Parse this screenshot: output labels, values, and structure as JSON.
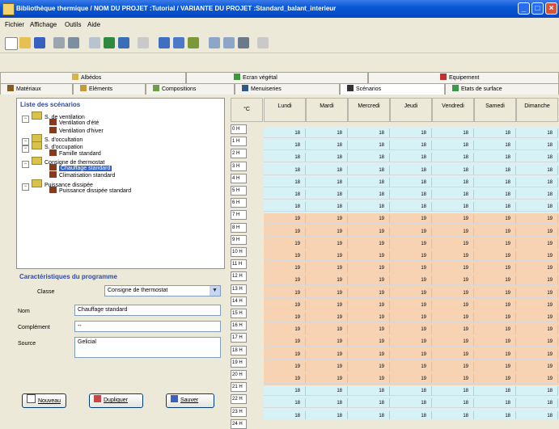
{
  "window": {
    "title": "Bibliothèque thermique / NOM DU PROJET :Tutorial / VARIANTE DU PROJET :Standard_balant_interieur"
  },
  "menu": [
    "Fichier",
    "Affichage",
    "Outils",
    "Aide"
  ],
  "tabs_row1": [
    {
      "label": "Albédos",
      "icon": "albedo-icon"
    },
    {
      "label": "Ecran végétal",
      "icon": "plant-icon"
    },
    {
      "label": "Equipement",
      "icon": "equipment-icon"
    }
  ],
  "tabs_row2": [
    {
      "label": "Matériaux",
      "icon": "material-icon"
    },
    {
      "label": "Eléments",
      "icon": "element-icon"
    },
    {
      "label": "Compositions",
      "icon": "composition-icon"
    },
    {
      "label": "Menuiseries",
      "icon": "window-icon"
    },
    {
      "label": "Scénarios",
      "icon": "scenario-icon",
      "active": true
    },
    {
      "label": "Etats de surface",
      "icon": "surface-icon"
    }
  ],
  "scenarios": {
    "title": "Liste des scénarios",
    "tree": [
      {
        "label": "S. de ventilation",
        "level": 0,
        "kind": "folder"
      },
      {
        "label": "Ventilation d'été",
        "level": 1,
        "kind": "leaf"
      },
      {
        "label": "Ventilation d'hiver",
        "level": 1,
        "kind": "leaf"
      },
      {
        "label": "S. d'occultation",
        "level": 0,
        "kind": "folder"
      },
      {
        "label": "S. d'occupation",
        "level": 0,
        "kind": "folder"
      },
      {
        "label": "Famille standard",
        "level": 1,
        "kind": "leaf"
      },
      {
        "label": "Consigne de thermostat",
        "level": 0,
        "kind": "folder"
      },
      {
        "label": "Chauffage standard",
        "level": 1,
        "kind": "leaf",
        "selected": true
      },
      {
        "label": "Climatisation standard",
        "level": 1,
        "kind": "leaf"
      },
      {
        "label": "Puissance dissipée",
        "level": 0,
        "kind": "folder"
      },
      {
        "label": "Puissance dissipée standard",
        "level": 1,
        "kind": "leaf"
      }
    ]
  },
  "characteristics": {
    "title": "Caractéristiques du programme",
    "classe_label": "Classe",
    "classe_value": "Consigne de thermostat",
    "nom_label": "Nom",
    "nom_value": "Chauffage standard",
    "complement_label": "Complément",
    "complement_value": "--",
    "source_label": "Source",
    "source_value": "Gelicial"
  },
  "buttons": {
    "new": "Nouveau",
    "duplicate": "Dupliquer",
    "save": "Sauver"
  },
  "schedule": {
    "unit": "°C",
    "days": [
      "Lundi",
      "Mardi",
      "Mercredi",
      "Jeudi",
      "Vendredi",
      "Samedi",
      "Dimanche"
    ],
    "hours": [
      "0 H",
      "1 H",
      "2 H",
      "3 H",
      "4 H",
      "5 H",
      "6 H",
      "7 H",
      "8 H",
      "9 H",
      "10 H",
      "11 H",
      "12 H",
      "13 H",
      "14 H",
      "15 H",
      "16 H",
      "17 H",
      "18 H",
      "19 H",
      "20 H",
      "21 H",
      "22 H",
      "23 H",
      "24 H"
    ],
    "values": [
      18,
      18,
      18,
      18,
      18,
      18,
      18,
      19,
      19,
      19,
      19,
      19,
      19,
      19,
      19,
      19,
      19,
      19,
      19,
      19,
      19,
      18,
      18,
      18
    ],
    "colors": {
      "low": "#d6f2f7",
      "high": "#f8d3b3"
    }
  }
}
